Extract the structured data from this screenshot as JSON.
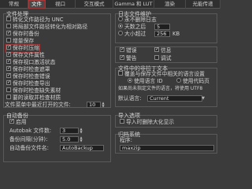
{
  "tabs": [
    {
      "label": "常规",
      "active": false
    },
    {
      "label": "文件",
      "active": true
    },
    {
      "label": "视口",
      "active": false
    },
    {
      "label": "交互模式",
      "active": false
    },
    {
      "label": "Gamma 和 LUT",
      "active": false
    },
    {
      "label": "渲染",
      "active": false
    },
    {
      "label": "光能传递",
      "active": false
    }
  ],
  "file_handling": {
    "title": "文件处理",
    "items": [
      {
        "label": "转化文件路径为 UNC",
        "checked": false
      },
      {
        "label": "将局部文件路径转化为相对路径",
        "checked": false
      },
      {
        "label": "保存时备份",
        "checked": true
      },
      {
        "label": "增量保存",
        "checked": false
      },
      {
        "label": "保存时压缩",
        "checked": true
      },
      {
        "label": "保存文件属性",
        "checked": true
      },
      {
        "label": "保存视口激活状态",
        "checked": true
      },
      {
        "label": "保存时检查遮罩",
        "checked": true
      },
      {
        "label": "保存时检查错误",
        "checked": true
      },
      {
        "label": "保存时检查导出",
        "checked": true
      },
      {
        "label": "保存时检查缺失素材",
        "checked": false
      },
      {
        "label": "要的读取并检查材质",
        "checked": false
      }
    ],
    "recent_files_label": "文件菜单中最近打开的文件:",
    "recent_files_value": "10"
  },
  "log_maintenance": {
    "title": "日志文件维护",
    "options": [
      {
        "label": "永不删除日志",
        "selected": false
      },
      {
        "label": "天数之后",
        "selected": true,
        "value": "5"
      },
      {
        "label": "大小超过",
        "selected": false,
        "value": "256",
        "unit": "KB"
      }
    ]
  },
  "error_log": {
    "items": [
      {
        "label": "错误",
        "checked": true
      },
      {
        "label": "信息",
        "checked": true
      },
      {
        "label": "警告",
        "checked": true
      },
      {
        "label": "调试",
        "checked": false
      }
    ]
  },
  "code_page": {
    "title": "文件中的非拉丁文本",
    "check_label": "覆盖与保存文件中相关的语言设置",
    "radio1": "使用语言 ID",
    "radio2": "使用代码页",
    "note": "如果尚未指定文件的语言，将使用 UTF8",
    "default_label": "默认语言:",
    "default_value": "Current"
  },
  "autobackup": {
    "title": "自动备份",
    "enable_label": "启用",
    "num_files_label": "Autobak 文件数:",
    "num_files_value": "3",
    "interval_label": "备份间隔(分钟):",
    "interval_value": "5.0",
    "file_name_label": "自动备份文件名:",
    "file_name_value": "AutoBackup"
  },
  "import_options": {
    "title": "导入选项",
    "item": "导入时删除大化显示"
  },
  "archive": {
    "title": "归档系统",
    "program_label": "程序:",
    "program_value": "maxzip"
  }
}
